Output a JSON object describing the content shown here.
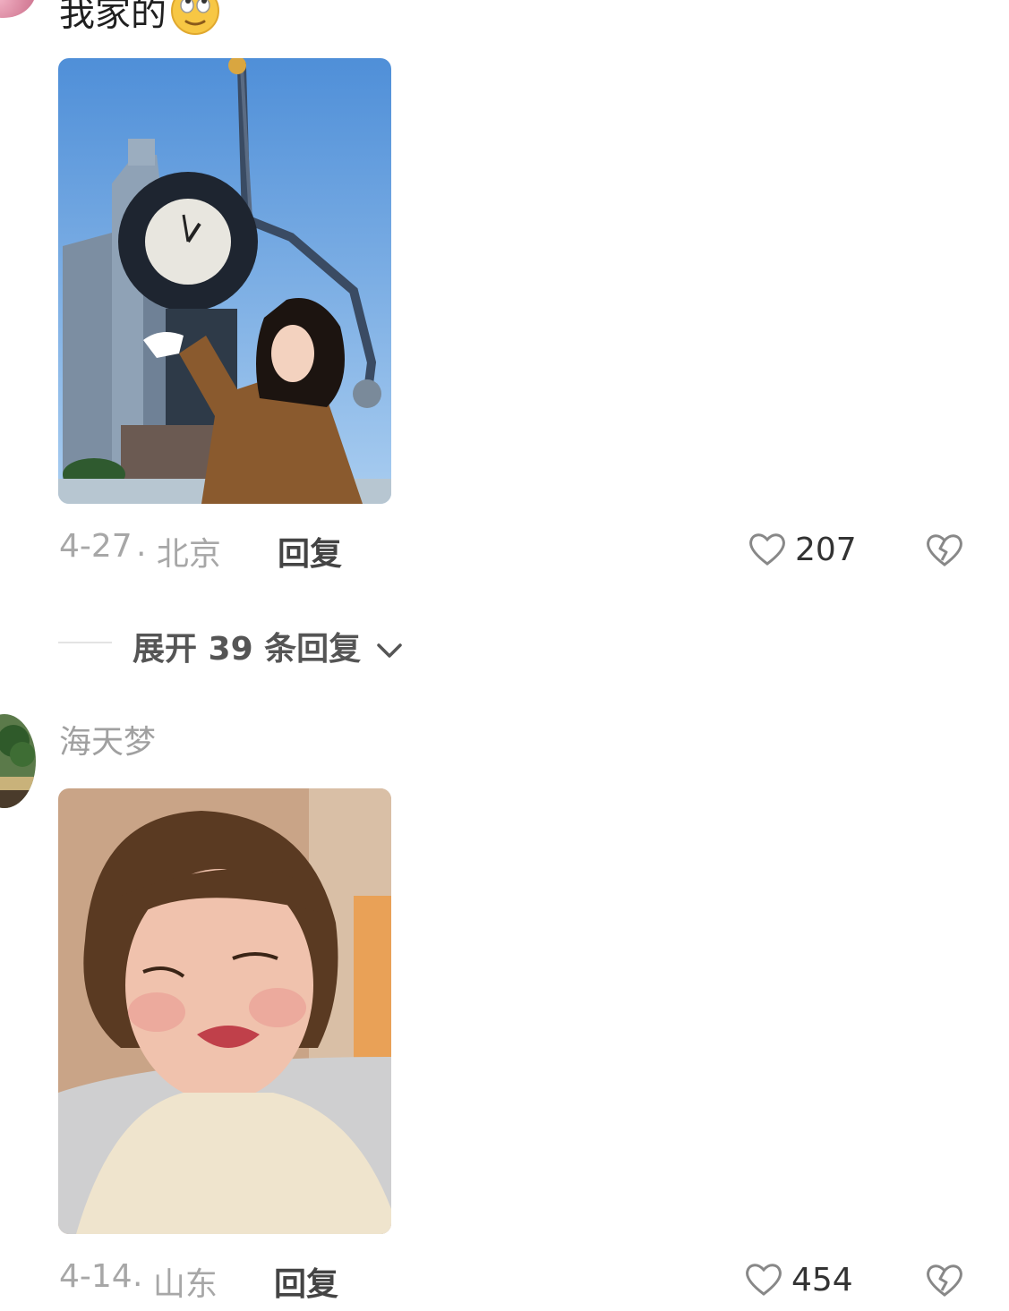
{
  "comments": [
    {
      "text": "我家的",
      "emoji": "rolling-eyes-emoji",
      "date": "4-27",
      "location": "· 北京",
      "reply_label": "回复",
      "likes": "207",
      "expand_label": "展开 39 条回复"
    },
    {
      "username": "海天梦",
      "date": "4-14",
      "location": "· 山东",
      "reply_label": "回复",
      "likes": "454"
    }
  ],
  "icons": {
    "like": "heart-outline-icon",
    "dislike": "broken-heart-icon",
    "expand": "chevron-down-icon"
  },
  "colors": {
    "meta_text": "#a7a7a7",
    "reply_text": "#444444"
  }
}
